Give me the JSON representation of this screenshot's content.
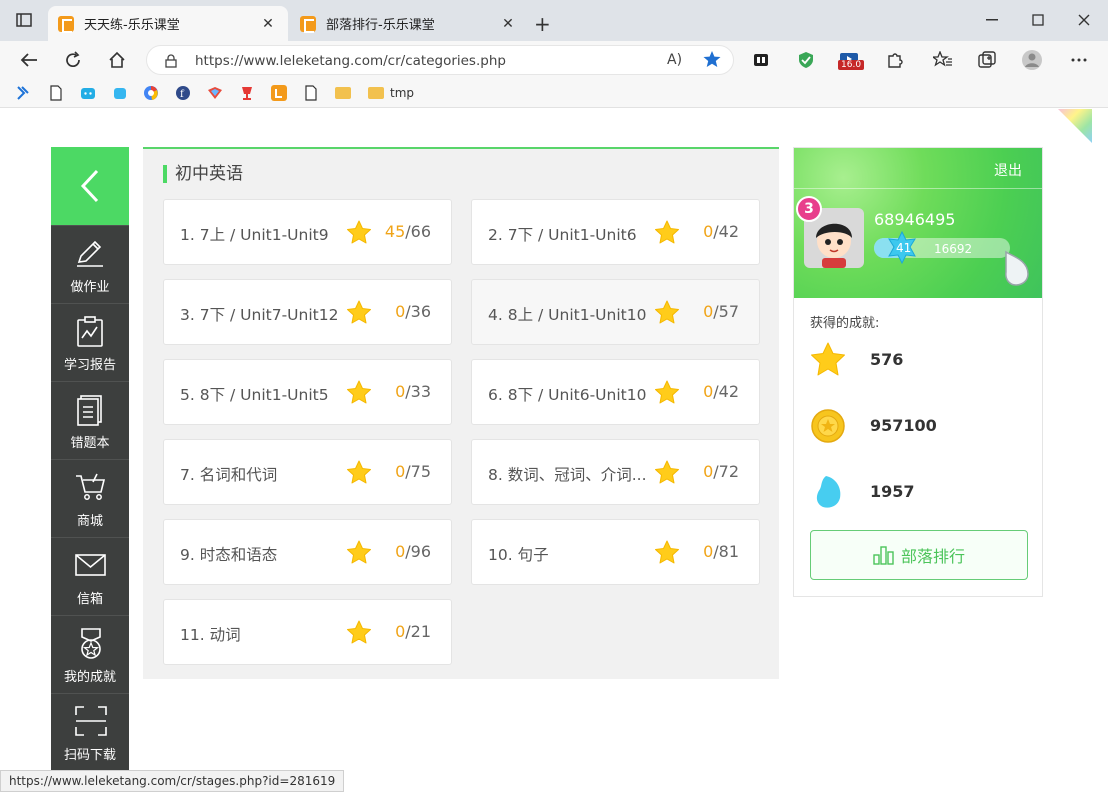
{
  "browser": {
    "tabs": [
      {
        "title": "天天练-乐乐课堂",
        "active": true
      },
      {
        "title": "部落排行-乐乐课堂",
        "active": false
      }
    ],
    "url": "https://www.leleketang.com/cr/categories.php",
    "extension_badge": "16.0",
    "bookmark_folder_label": "tmp",
    "status_url": "https://www.leleketang.com/cr/stages.php?id=281619"
  },
  "sidebar": {
    "items": [
      {
        "label": "做作业",
        "icon": "pencil-icon"
      },
      {
        "label": "学习报告",
        "icon": "report-icon"
      },
      {
        "label": "错题本",
        "icon": "notebook-icon"
      },
      {
        "label": "商城",
        "icon": "cart-icon"
      },
      {
        "label": "信箱",
        "icon": "mail-icon"
      },
      {
        "label": "我的成就",
        "icon": "medal-icon"
      },
      {
        "label": "扫码下载",
        "icon": "scan-icon"
      }
    ]
  },
  "content": {
    "title": "初中英语",
    "units": [
      {
        "name": "1. 7上 / Unit1-Unit9",
        "earned": "45",
        "total": "/66"
      },
      {
        "name": "2. 7下 / Unit1-Unit6",
        "earned": "0",
        "total": "/42"
      },
      {
        "name": "3. 7下 / Unit7-Unit12",
        "earned": "0",
        "total": "/36"
      },
      {
        "name": "4. 8上 / Unit1-Unit10",
        "earned": "0",
        "total": "/57"
      },
      {
        "name": "5. 8下 / Unit1-Unit5",
        "earned": "0",
        "total": "/33"
      },
      {
        "name": "6. 8下 / Unit6-Unit10",
        "earned": "0",
        "total": "/42"
      },
      {
        "name": "7. 名词和代词",
        "earned": "0",
        "total": "/75"
      },
      {
        "name": "8. 数词、冠词、介词...",
        "earned": "0",
        "total": "/72"
      },
      {
        "name": "9. 时态和语态",
        "earned": "0",
        "total": "/96"
      },
      {
        "name": "10. 句子",
        "earned": "0",
        "total": "/81"
      },
      {
        "name": "11. 动词",
        "earned": "0",
        "total": "/21"
      }
    ]
  },
  "profile": {
    "logout_label": "退出",
    "level_badge": "3",
    "user_id": "68946495",
    "xp_level": "41",
    "xp_points": "16692",
    "achievements_title": "获得的成就:",
    "stars": "576",
    "coins": "957100",
    "drops": "1957",
    "rank_button_label": "部落排行"
  },
  "colors": {
    "accent_green": "#4cd964",
    "sidebar_dark": "#3d3f3e",
    "score_orange": "#f0a418"
  }
}
